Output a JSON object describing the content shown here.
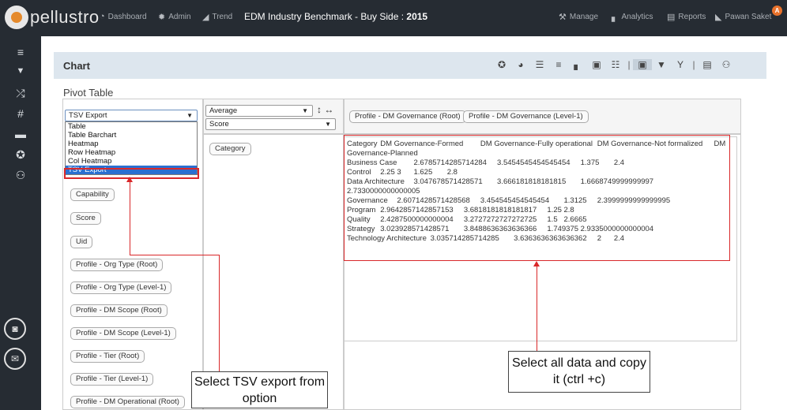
{
  "topbar": {
    "logo_text": "pellustro",
    "nav": [
      {
        "icon": "dashboard-icon",
        "glyph": "◔",
        "label": "Dashboard"
      },
      {
        "icon": "gear-icon",
        "glyph": "✹",
        "label": "Admin"
      },
      {
        "icon": "trend-icon",
        "glyph": "◢",
        "label": "Trend"
      }
    ],
    "title_prefix": "EDM Industry Benchmark - Buy Side : ",
    "title_year": "2015",
    "right_nav": [
      {
        "icon": "wrench-icon",
        "glyph": "⚒",
        "label": "Manage"
      },
      {
        "icon": "analytics-icon",
        "glyph": "▖",
        "label": "Analytics"
      },
      {
        "icon": "reports-icon",
        "glyph": "▤",
        "label": "Reports"
      },
      {
        "icon": "user-icon",
        "glyph": "◣",
        "label": "Pawan Saket"
      }
    ],
    "notification_count": "A",
    "colors": {
      "bar": "#262c33",
      "badge": "#e8722c"
    }
  },
  "sidebar": {
    "icons": [
      "menu-icon",
      "filter-icon",
      "shuffle-icon",
      "columns-icon",
      "box-icon",
      "globe-icon",
      "users-icon"
    ],
    "glyphs": [
      "≡",
      "▼",
      "⤮",
      "#",
      "▬",
      "✪",
      "⚇"
    ]
  },
  "chart_header": {
    "title": "Chart",
    "tool_glyphs": [
      "✪",
      "◕",
      "☰",
      "≡",
      "▖",
      "▣",
      "☷",
      "|",
      "▣",
      "▼",
      "Y",
      "|",
      "▤",
      "⚇"
    ]
  },
  "pivot": {
    "title": "Pivot Table",
    "renderer": {
      "selected": "TSV Export",
      "options": [
        "Table",
        "Table Barchart",
        "Heatmap",
        "Row Heatmap",
        "Col Heatmap",
        "TSV Export"
      ]
    },
    "aggregator": {
      "selected": "Average"
    },
    "aggregator_field": {
      "selected": "Score"
    },
    "column_fields": [
      "Profile - DM Governance (Root)",
      "Profile - DM Governance (Level-1)"
    ],
    "row_fields": [
      "Category"
    ],
    "unused_fields": [
      "Capability",
      "Score",
      "Uid",
      "Profile - Org Type (Root)",
      "Profile - Org Type (Level-1)",
      "Profile - DM Scope (Root)",
      "Profile - DM Scope (Level-1)",
      "Profile - Tier (Root)",
      "Profile - Tier (Level-1)",
      "Profile - DM Operational (Root)"
    ],
    "tsv_output": "Category\tDM Governance-Formed\tDM Governance-Fully operational\tDM Governance-Not formalized\tDM Governance-Planned\nBusiness Case\t2.6785714285714284\t3.5454545454545454\t1.375\t2.4\nControl\t2.25\t3\t1.625\t2.8\nData Architecture\t3.047678571428571\t3.666181818181815\t1.6668749999999997\t2.7330000000000005\nGovernance\t2.6071428571428568\t3.454545454545454\t1.3125\t2.3999999999999995\nProgram\t2.9642857142857153\t3.6818181818181817\t1.25\t2.8\nQuality\t2.4287500000000004\t3.2727272727272725\t1.5\t2.6665\nStrategy\t3.023928571428571\t3.8488636363636366\t1.749375\t2.9335000000000004\nTechnology Architecture\t3.035714285714285\t3.6363636363636362\t2\t2.4"
  },
  "callouts": {
    "export": "Select TSV export from option",
    "copy": "Select all data and copy it (ctrl +c)"
  },
  "annotation_color": "#d9282a"
}
